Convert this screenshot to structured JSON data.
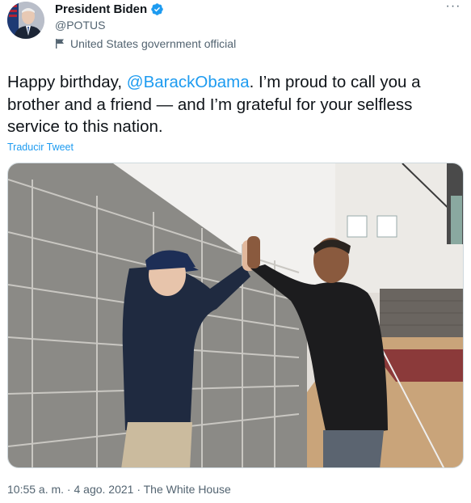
{
  "author": {
    "name": "President Biden",
    "handle": "@POTUS",
    "label": "United States government official",
    "avatar_icon": "profile-photo-biden",
    "verified_icon": "verified-badge-icon",
    "verified_color": "#1d9bf0"
  },
  "menu": {
    "more_label": "···"
  },
  "tweet": {
    "text_before": "Happy birthday, ",
    "mention": "@BarackObama",
    "text_after": ". I’m proud to call you a brother and a friend — and I’m grateful for your selfless service to this nation.",
    "translate_label": "Traducir Tweet",
    "mention_color": "#1d9bf0"
  },
  "media": {
    "alt": "",
    "type": "photo"
  },
  "footer": {
    "timestamp": "10:55 a. m. · 4 ago. 2021 · The White House"
  }
}
